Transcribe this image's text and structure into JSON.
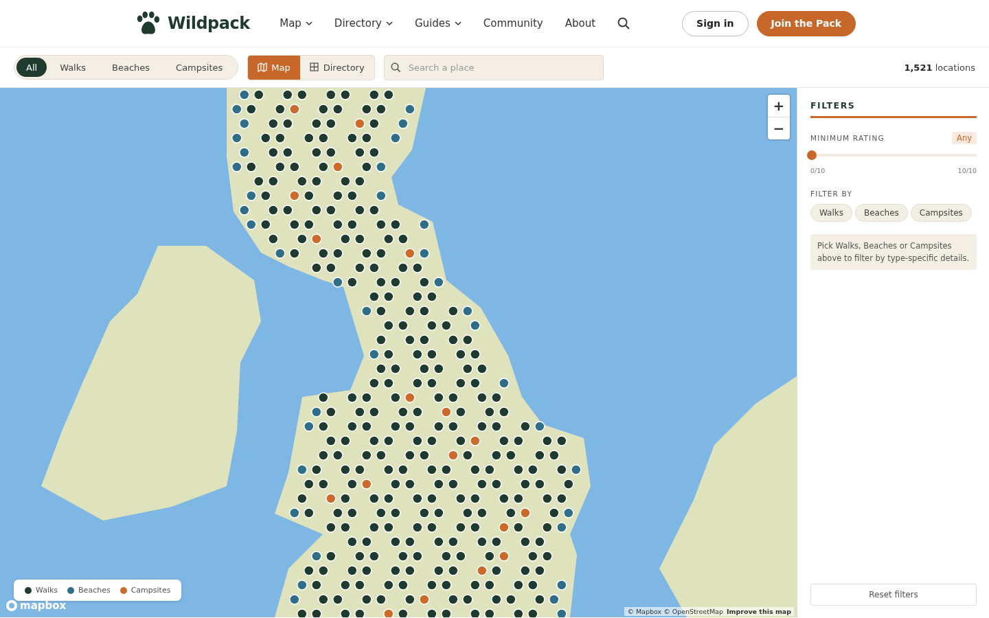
{
  "brand": {
    "name": "Wildpack"
  },
  "nav": [
    {
      "label": "Map",
      "kind": "dropdown"
    },
    {
      "label": "Directory",
      "kind": "dropdown"
    },
    {
      "label": "Guides",
      "kind": "dropdown"
    },
    {
      "label": "Community",
      "kind": "link"
    },
    {
      "label": "About",
      "kind": "link"
    }
  ],
  "actions": [
    {
      "label": "Sign in",
      "kind": "outline"
    },
    {
      "label": "Join the Pack",
      "kind": "primary"
    }
  ],
  "category_tabs": [
    {
      "label": "All",
      "selected": true
    },
    {
      "label": "Walks",
      "selected": false
    },
    {
      "label": "Beaches",
      "selected": false
    },
    {
      "label": "Campsites",
      "selected": false
    }
  ],
  "view_toggle": [
    {
      "label": "Map",
      "kind": "map",
      "selected": true
    },
    {
      "label": "Directory",
      "kind": "grid",
      "selected": false
    }
  ],
  "search": {
    "placeholder": "Search a place"
  },
  "count": {
    "number": "1,521",
    "unit": "locations"
  },
  "map": {
    "zoom_in": "+",
    "zoom_out": "−",
    "legend": [
      {
        "label": "Walks",
        "color": "#1f3a2e"
      },
      {
        "label": "Beaches",
        "color": "#2f6e86"
      },
      {
        "label": "Campsites",
        "color": "#cc6a2c"
      }
    ],
    "logo": "mapbox",
    "attribution": "© Mapbox © OpenStreetMap",
    "improve": "Improve this map"
  },
  "filters": {
    "title": "FILTERS",
    "rating_label": "MINIMUM RATING",
    "rating_value": "Any",
    "level": 0,
    "min": "0/10",
    "max": "10/10",
    "filter_by": "FILTER BY",
    "chips": [
      {
        "label": "Walks",
        "selected": false
      },
      {
        "label": "Beaches",
        "selected": false
      },
      {
        "label": "Campsites",
        "selected": false
      }
    ],
    "hint": "Pick Walks, Beaches or Campsites above to filter by type-specific details.",
    "reset": "Reset filters"
  }
}
